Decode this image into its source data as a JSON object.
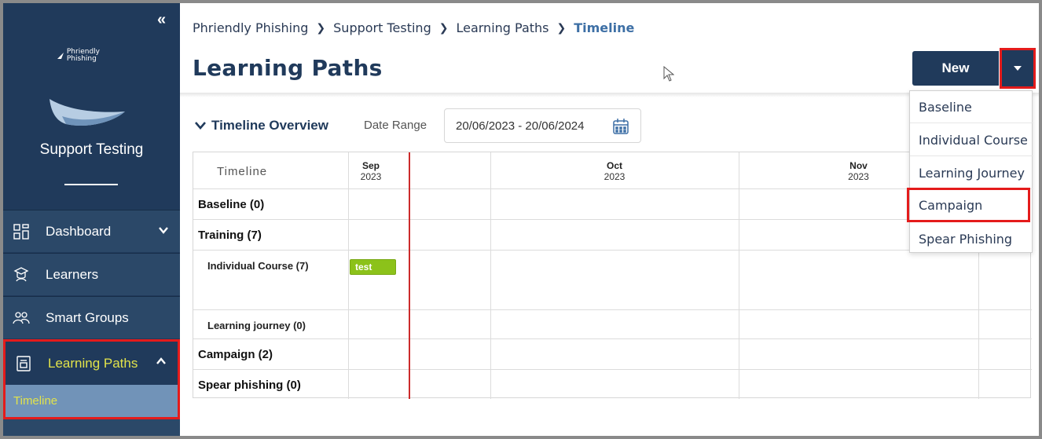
{
  "sidebar": {
    "logo_text_1": "Phriendly",
    "logo_text_2": "Phishing",
    "org_name": "Support Testing",
    "items": [
      {
        "label": "Dashboard"
      },
      {
        "label": "Learners"
      },
      {
        "label": "Smart Groups"
      },
      {
        "label": "Learning Paths"
      }
    ],
    "subitem": "Timeline"
  },
  "breadcrumb": [
    "Phriendly Phishing",
    "Support Testing",
    "Learning Paths",
    "Timeline"
  ],
  "page_title": "Learning Paths",
  "new_button": "New",
  "menu": [
    "Baseline",
    "Individual Course",
    "Learning Journey",
    "Campaign",
    "Spear Phishing"
  ],
  "timeline": {
    "heading": "Timeline Overview",
    "date_range_label": "Date Range",
    "date_range_value": "20/06/2023 - 20/06/2024",
    "col_header": "Timeline",
    "months": [
      {
        "month": "Sep",
        "year": "2023"
      },
      {
        "month": "Oct",
        "year": "2023"
      },
      {
        "month": "Nov",
        "year": "2023"
      }
    ],
    "rows": [
      "Baseline (0)",
      "Training (7)",
      "Individual Course (7)",
      "Learning journey (0)",
      "Campaign (2)",
      "Spear phishing (0)"
    ],
    "bar_label": "test"
  },
  "colors": {
    "sidebar": "#203a5b",
    "accent_text": "#e2e34a",
    "highlight": "#e41b1b",
    "bar": "#8cc21a",
    "today_line": "#cc2b2b"
  }
}
